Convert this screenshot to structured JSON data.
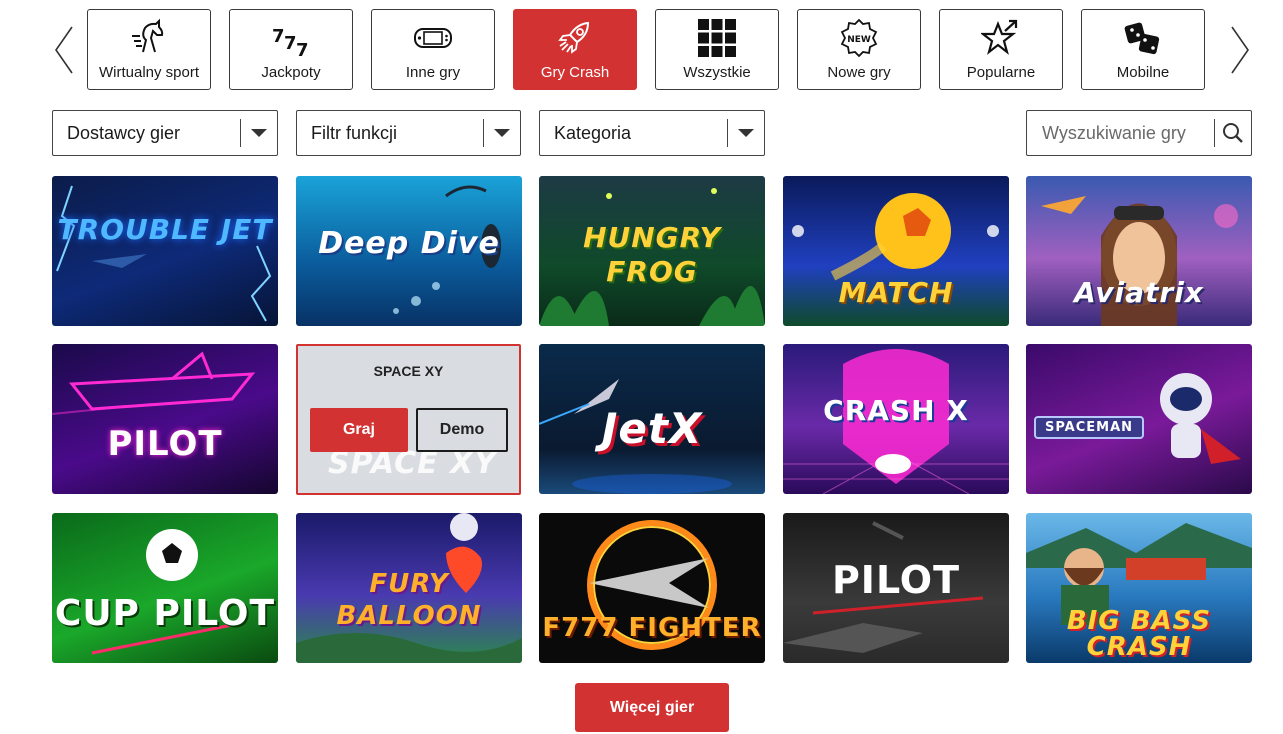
{
  "categories": [
    {
      "label": "Wirtualny sport",
      "icon": "horse-icon",
      "active": false
    },
    {
      "label": "Jackpoty",
      "icon": "777-icon",
      "active": false
    },
    {
      "label": "Inne gry",
      "icon": "handheld-console-icon",
      "active": false
    },
    {
      "label": "Gry Crash",
      "icon": "rocket-icon",
      "active": true
    },
    {
      "label": "Wszystkie",
      "icon": "grid-icon",
      "active": false
    },
    {
      "label": "Nowe gry",
      "icon": "new-badge-icon",
      "active": false
    },
    {
      "label": "Popularne",
      "icon": "star-arrow-icon",
      "active": false
    },
    {
      "label": "Mobilne",
      "icon": "dice-icon",
      "active": false
    }
  ],
  "filters": {
    "providers": "Dostawcy gier",
    "features": "Filtr funkcji",
    "category": "Kategoria"
  },
  "search": {
    "placeholder": "Wyszukiwanie gry"
  },
  "games": [
    {
      "title": "TROUBLE JET"
    },
    {
      "title": "Deep Dive"
    },
    {
      "title": "HUNGRY FROG"
    },
    {
      "title": "MATCH"
    },
    {
      "title": "Aviatrix"
    },
    {
      "title": "PILOT"
    },
    {
      "title": "SPACE XY"
    },
    {
      "title": "JetX"
    },
    {
      "title": "CRASH X"
    },
    {
      "title": "SPACEMAN"
    },
    {
      "title": "CUP PILOT"
    },
    {
      "title": "FURY BALLOON"
    },
    {
      "title": "F777 FIGHTER"
    },
    {
      "title": "PILOT"
    },
    {
      "title": "BIG BASS CRASH"
    }
  ],
  "hover": {
    "name": "SPACE XY",
    "play": "Graj",
    "demo": "Demo"
  },
  "more_button": "Więcej gier",
  "colors": {
    "accent": "#d23232"
  }
}
